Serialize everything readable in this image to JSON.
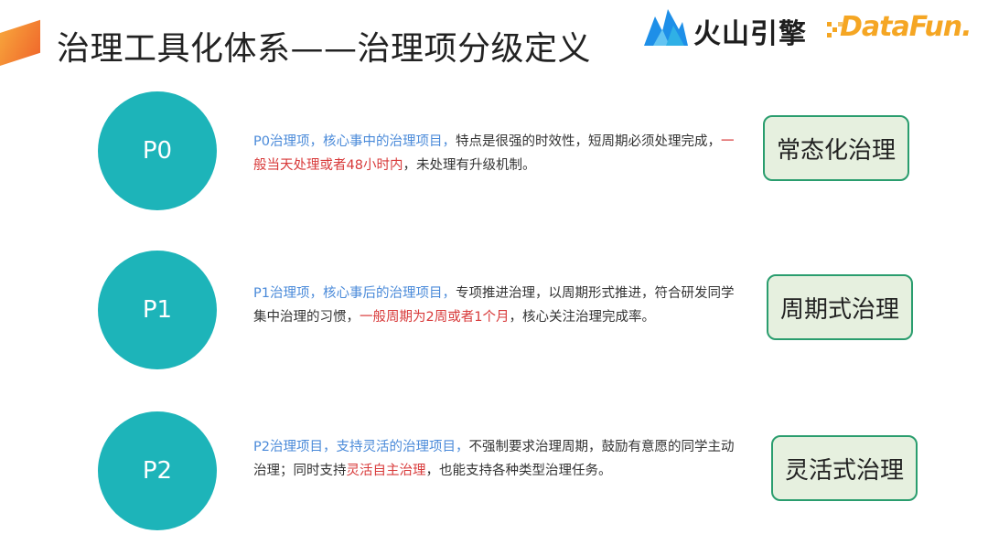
{
  "title": "治理工具化体系——治理项分级定义",
  "logos": {
    "volcano_text": "火山引擎",
    "datafun_text": "DataFun.",
    "brand_colors": {
      "volcano_blue": "#1e8fe8",
      "datafun_orange": "#f5a623"
    }
  },
  "rows": [
    {
      "level": "P0",
      "desc_blue": "P0治理项，核心事中的治理项目，",
      "desc_text1": "特点是很强的时效性，短周期必须处理完成，",
      "desc_red": "一般当天处理或者48小时内",
      "desc_text2": "，未处理有升级机制。",
      "tag": "常态化治理"
    },
    {
      "level": "P1",
      "desc_blue": "P1治理项，核心事后的治理项目，",
      "desc_text1": "专项推进治理，以周期形式推进，符合研发同学集中治理的习惯，",
      "desc_red": "一般周期为2周或者1个月",
      "desc_text2": "，核心关注治理完成率。",
      "tag": "周期式治理"
    },
    {
      "level": "P2",
      "desc_blue": "P2治理项目，支持灵活的治理项目，",
      "desc_text1": "不强制要求治理周期，鼓励有意愿的同学主动治理；同时支持",
      "desc_red": "灵活自主治理",
      "desc_text2": "，也能支持各种类型治理任务。",
      "tag": "灵活式治理"
    }
  ],
  "colors": {
    "circle": "#1db4b9",
    "highlight_blue": "#4a8ad9",
    "highlight_red": "#d83a3a",
    "tag_border": "#2a9d6e",
    "tag_fill": "#e6f0df"
  }
}
